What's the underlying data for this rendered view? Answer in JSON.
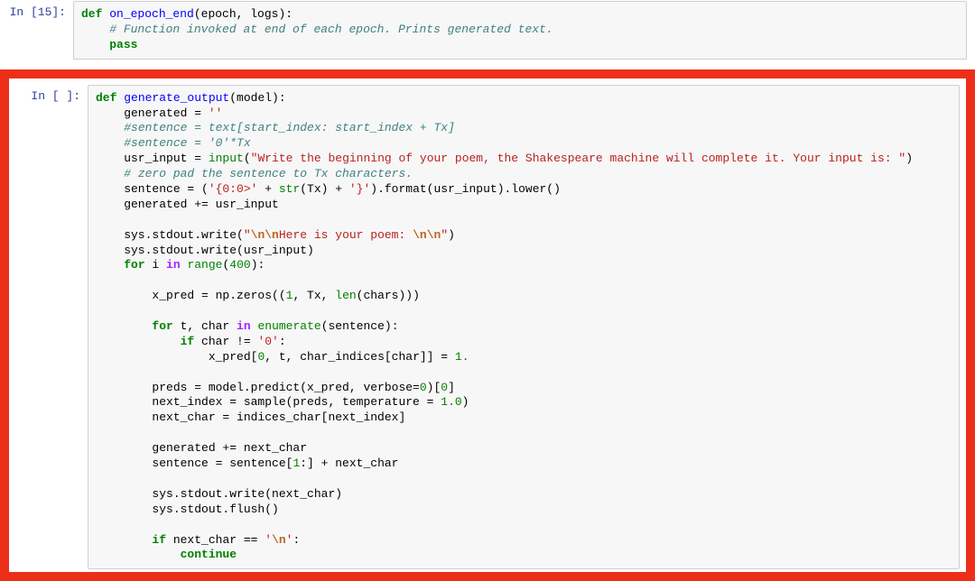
{
  "cells": [
    {
      "prompt": "In [15]:",
      "tokens": [
        [
          [
            "kw",
            "def"
          ],
          [
            "",
            " "
          ],
          [
            "fn",
            "on_epoch_end"
          ],
          [
            "",
            "(epoch, logs):"
          ]
        ],
        [
          [
            "",
            "    "
          ],
          [
            "cm",
            "# Function invoked at end of each epoch. Prints generated text."
          ]
        ],
        [
          [
            "",
            "    "
          ],
          [
            "kw",
            "pass"
          ]
        ]
      ]
    },
    {
      "prompt": "In [ ]:",
      "tokens": [
        [
          [
            "kw",
            "def"
          ],
          [
            "",
            " "
          ],
          [
            "fn",
            "generate_output"
          ],
          [
            "",
            "(model):"
          ]
        ],
        [
          [
            "",
            "    generated = "
          ],
          [
            "st",
            "''"
          ]
        ],
        [
          [
            "",
            "    "
          ],
          [
            "cm",
            "#sentence = text[start_index: start_index + Tx]"
          ]
        ],
        [
          [
            "",
            "    "
          ],
          [
            "cm",
            "#sentence = '0'*Tx"
          ]
        ],
        [
          [
            "",
            "    usr_input = "
          ],
          [
            "bi",
            "input"
          ],
          [
            "",
            "("
          ],
          [
            "st",
            "\"Write the beginning of your poem, the Shakespeare machine will complete it. Your input is: \""
          ],
          [
            "",
            ")"
          ]
        ],
        [
          [
            "",
            "    "
          ],
          [
            "cm",
            "# zero pad the sentence to Tx characters."
          ]
        ],
        [
          [
            "",
            "    sentence = ("
          ],
          [
            "st",
            "'{0:0>'"
          ],
          [
            "",
            " + "
          ],
          [
            "bi",
            "str"
          ],
          [
            "",
            "(Tx) + "
          ],
          [
            "st",
            "'}'"
          ],
          [
            "",
            ").format(usr_input).lower()"
          ]
        ],
        [
          [
            "",
            "    generated += usr_input"
          ]
        ],
        [
          [
            "",
            ""
          ]
        ],
        [
          [
            "",
            "    sys.stdout.write("
          ],
          [
            "st",
            "\""
          ],
          [
            "se",
            "\\n\\n"
          ],
          [
            "st",
            "Here is your poem: "
          ],
          [
            "se",
            "\\n\\n"
          ],
          [
            "st",
            "\""
          ],
          [
            "",
            ")"
          ]
        ],
        [
          [
            "",
            "    sys.stdout.write(usr_input)"
          ]
        ],
        [
          [
            "",
            "    "
          ],
          [
            "kw",
            "for"
          ],
          [
            "",
            " i "
          ],
          [
            "op",
            "in"
          ],
          [
            "",
            " "
          ],
          [
            "bi",
            "range"
          ],
          [
            "",
            "("
          ],
          [
            "nm",
            "400"
          ],
          [
            "",
            "):"
          ]
        ],
        [
          [
            "",
            ""
          ]
        ],
        [
          [
            "",
            "        x_pred = np.zeros(("
          ],
          [
            "nm",
            "1"
          ],
          [
            "",
            ", Tx, "
          ],
          [
            "bi",
            "len"
          ],
          [
            "",
            "(chars)))"
          ]
        ],
        [
          [
            "",
            ""
          ]
        ],
        [
          [
            "",
            "        "
          ],
          [
            "kw",
            "for"
          ],
          [
            "",
            " t, char "
          ],
          [
            "op",
            "in"
          ],
          [
            "",
            " "
          ],
          [
            "bi",
            "enumerate"
          ],
          [
            "",
            "(sentence):"
          ]
        ],
        [
          [
            "",
            "            "
          ],
          [
            "kw",
            "if"
          ],
          [
            "",
            " char != "
          ],
          [
            "st",
            "'0'"
          ],
          [
            "",
            ":"
          ]
        ],
        [
          [
            "",
            "                x_pred["
          ],
          [
            "nm",
            "0"
          ],
          [
            "",
            ", t, char_indices[char]] = "
          ],
          [
            "nm",
            "1."
          ]
        ],
        [
          [
            "",
            ""
          ]
        ],
        [
          [
            "",
            "        preds = model.predict(x_pred, verbose="
          ],
          [
            "nm",
            "0"
          ],
          [
            "",
            ")["
          ],
          [
            "nm",
            "0"
          ],
          [
            "",
            "]"
          ]
        ],
        [
          [
            "",
            "        next_index = sample(preds, temperature = "
          ],
          [
            "nm",
            "1.0"
          ],
          [
            "",
            ")"
          ]
        ],
        [
          [
            "",
            "        next_char = indices_char[next_index]"
          ]
        ],
        [
          [
            "",
            ""
          ]
        ],
        [
          [
            "",
            "        generated += next_char"
          ]
        ],
        [
          [
            "",
            "        sentence = sentence["
          ],
          [
            "nm",
            "1"
          ],
          [
            "",
            ":] + next_char"
          ]
        ],
        [
          [
            "",
            ""
          ]
        ],
        [
          [
            "",
            "        sys.stdout.write(next_char)"
          ]
        ],
        [
          [
            "",
            "        sys.stdout.flush()"
          ]
        ],
        [
          [
            "",
            ""
          ]
        ],
        [
          [
            "",
            "        "
          ],
          [
            "kw",
            "if"
          ],
          [
            "",
            " next_char == "
          ],
          [
            "st",
            "'"
          ],
          [
            "se",
            "\\n"
          ],
          [
            "st",
            "'"
          ],
          [
            "",
            ":"
          ]
        ],
        [
          [
            "",
            "            "
          ],
          [
            "kw",
            "continue"
          ]
        ]
      ]
    }
  ],
  "watermark": ""
}
